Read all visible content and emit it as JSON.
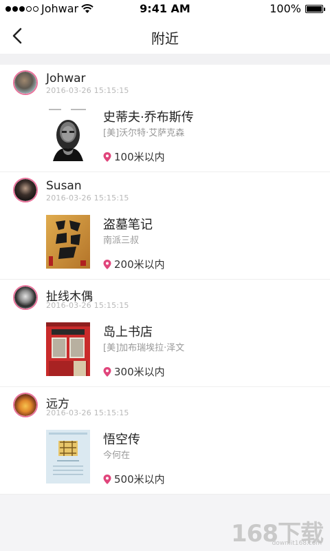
{
  "status_bar": {
    "carrier": "Johwar",
    "time": "9:41 AM",
    "battery": "100%"
  },
  "navbar": {
    "title": "附近"
  },
  "items": [
    {
      "user": "Johwar",
      "timestamp": "2016-03-26 15:15:15",
      "book_title": "史蒂夫·乔布斯传",
      "author": "[美]沃尔特·艾萨克森",
      "distance": "100米以内"
    },
    {
      "user": "Susan",
      "timestamp": "2016-03-26 15:15:15",
      "book_title": "盗墓笔记",
      "author": "南派三叔",
      "distance": "200米以内"
    },
    {
      "user": "扯线木偶",
      "timestamp": "2016-03-26 15:15:15",
      "book_title": "岛上书店",
      "author": "[美]加布瑞埃拉·泽文",
      "distance": "300米以内"
    },
    {
      "user": "远方",
      "timestamp": "2016-03-26 15:15:15",
      "book_title": "悟空传",
      "author": "今何在",
      "distance": "500米以内"
    }
  ],
  "watermark": {
    "brand": "168下载",
    "url": "down.it168.com"
  },
  "colors": {
    "accent_pink": "#e9729b",
    "pin": "#e0457b"
  }
}
